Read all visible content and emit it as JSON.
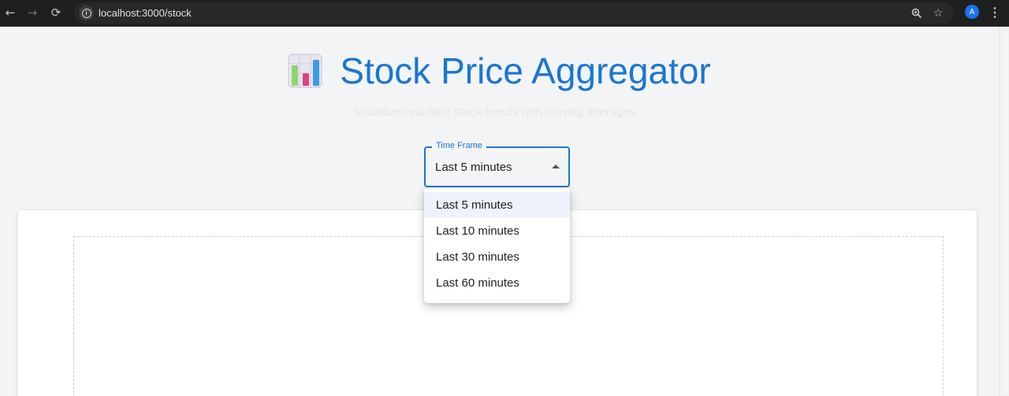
{
  "browser": {
    "url": "localhost:3000/stock",
    "profile_initial": "A",
    "icons": [
      "back-arrow-icon",
      "forward-arrow-icon",
      "reload-icon",
      "site-info-icon",
      "zoom-icon",
      "bookmark-star-icon",
      "kebab-menu-icon"
    ]
  },
  "header": {
    "title": "Stock Price Aggregator",
    "subtitle": "Visualize real-time stock trends with moving averages.",
    "logo_icon": "bar-chart-icon"
  },
  "time_frame": {
    "label": "Time Frame",
    "selected": "Last 5 minutes",
    "options": [
      "Last 5 minutes",
      "Last 10 minutes",
      "Last 30 minutes",
      "Last 60 minutes"
    ]
  },
  "colors": {
    "accent": "#1976d2",
    "page_bg": "#f3f4f6",
    "menu_selected_bg": "#edf2fb"
  }
}
